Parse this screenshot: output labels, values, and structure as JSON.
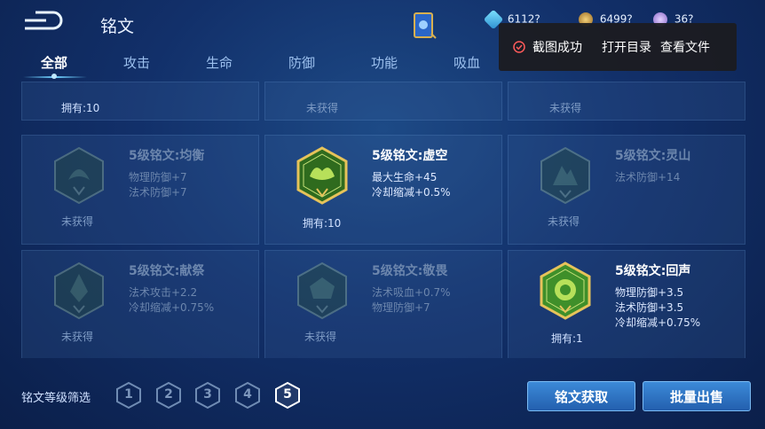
{
  "header": {
    "title": "铭文",
    "resources": [
      {
        "icon": "diamond-icon",
        "value": "6112?"
      },
      {
        "icon": "coin-icon",
        "value": "6499?"
      },
      {
        "icon": "gem-icon",
        "value": "36?"
      }
    ]
  },
  "tabs": [
    {
      "label": "全部",
      "active": true
    },
    {
      "label": "攻击",
      "active": false
    },
    {
      "label": "生命",
      "active": false
    },
    {
      "label": "防御",
      "active": false
    },
    {
      "label": "功能",
      "active": false
    },
    {
      "label": "吸血",
      "active": false
    }
  ],
  "toast": {
    "message": "截图成功",
    "open_dir": "打开目录",
    "view_file": "查看文件"
  },
  "inscriptions": {
    "row0": [
      {
        "status": "拥有:10"
      },
      {
        "status": "未获得"
      },
      {
        "status": "未获得"
      }
    ],
    "row1": [
      {
        "name": "5级铭文:均衡",
        "stats": [
          "物理防御+7",
          "法术防御+7"
        ],
        "status": "未获得",
        "owned": false
      },
      {
        "name": "5级铭文:虚空",
        "stats": [
          "最大生命+45",
          "冷却缩减+0.5%"
        ],
        "status": "拥有:10",
        "owned": true
      },
      {
        "name": "5级铭文:灵山",
        "stats": [
          "法术防御+14"
        ],
        "status": "未获得",
        "owned": false
      }
    ],
    "row2": [
      {
        "name": "5级铭文:献祭",
        "stats": [
          "法术攻击+2.2",
          "冷却缩减+0.75%"
        ],
        "status": "未获得",
        "owned": false
      },
      {
        "name": "5级铭文:敬畏",
        "stats": [
          "法术吸血+0.7%",
          "物理防御+7"
        ],
        "status": "未获得",
        "owned": false
      },
      {
        "name": "5级铭文:回声",
        "stats": [
          "物理防御+3.5",
          "法术防御+3.5",
          "冷却缩减+0.75%"
        ],
        "status": "拥有:1",
        "owned": true
      }
    ]
  },
  "filter": {
    "label": "铭文等级筛选",
    "levels": [
      "1",
      "2",
      "3",
      "4",
      "5"
    ],
    "active_level": "5"
  },
  "buttons": {
    "acquire": "铭文获取",
    "bulk_sell": "批量出售"
  },
  "colors": {
    "accent": "#3c8ad8",
    "emblem_green": "#3f8f2a",
    "emblem_gold": "#e6c35a",
    "toast_bg": "#1c1c20"
  }
}
